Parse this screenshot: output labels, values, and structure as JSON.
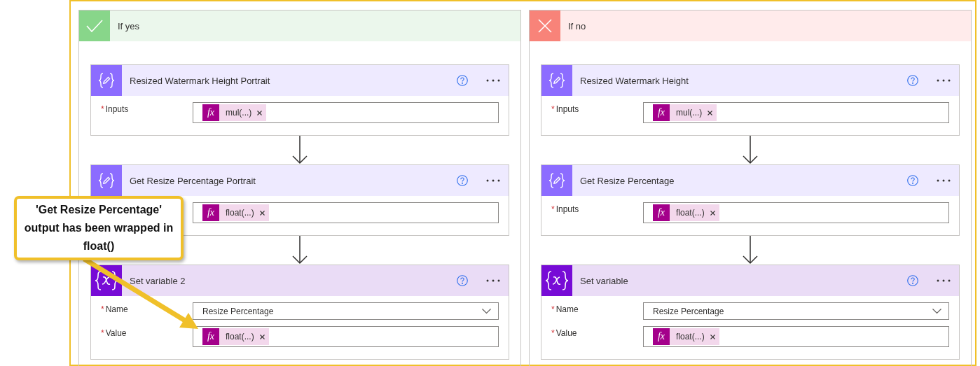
{
  "branches": [
    {
      "kind": "yes",
      "title": "If yes",
      "cards": [
        {
          "kind": "compose",
          "title": "Resized Watermark Height Portrait",
          "fields": [
            {
              "kind": "token",
              "label": "Inputs",
              "required_mark": "*",
              "icon": "fx",
              "token": "mul(...)"
            }
          ]
        },
        {
          "kind": "compose",
          "title": "Get Resize Percentage Portrait",
          "fields": [
            {
              "kind": "token",
              "icon": "fx",
              "token": "float(...)"
            }
          ]
        },
        {
          "kind": "variable",
          "title": "Set variable 2",
          "fields": [
            {
              "kind": "dropdown",
              "label": "Name",
              "required_mark": "*",
              "value": "Resize Percentage"
            },
            {
              "kind": "token",
              "label": "Value",
              "required_mark": "*",
              "icon": "fx",
              "token": "float(...)"
            }
          ]
        }
      ]
    },
    {
      "kind": "no",
      "title": "If no",
      "cards": [
        {
          "kind": "compose",
          "title": "Resized Watermark Height",
          "fields": [
            {
              "kind": "token",
              "label": "Inputs",
              "required_mark": "*",
              "icon": "fx",
              "token": "mul(...)"
            }
          ]
        },
        {
          "kind": "compose",
          "title": "Get Resize Percentage",
          "fields": [
            {
              "kind": "token",
              "label": "Inputs",
              "required_mark": "*",
              "icon": "fx",
              "token": "float(...)"
            }
          ]
        },
        {
          "kind": "variable",
          "title": "Set variable",
          "fields": [
            {
              "kind": "dropdown",
              "label": "Name",
              "required_mark": "*",
              "value": "Resize Percentage"
            },
            {
              "kind": "token",
              "label": "Value",
              "required_mark": "*",
              "icon": "fx",
              "token": "float(...)"
            }
          ]
        }
      ]
    }
  ],
  "callout": {
    "text": "'Get Resize Percentage' output has been wrapped in float()"
  }
}
